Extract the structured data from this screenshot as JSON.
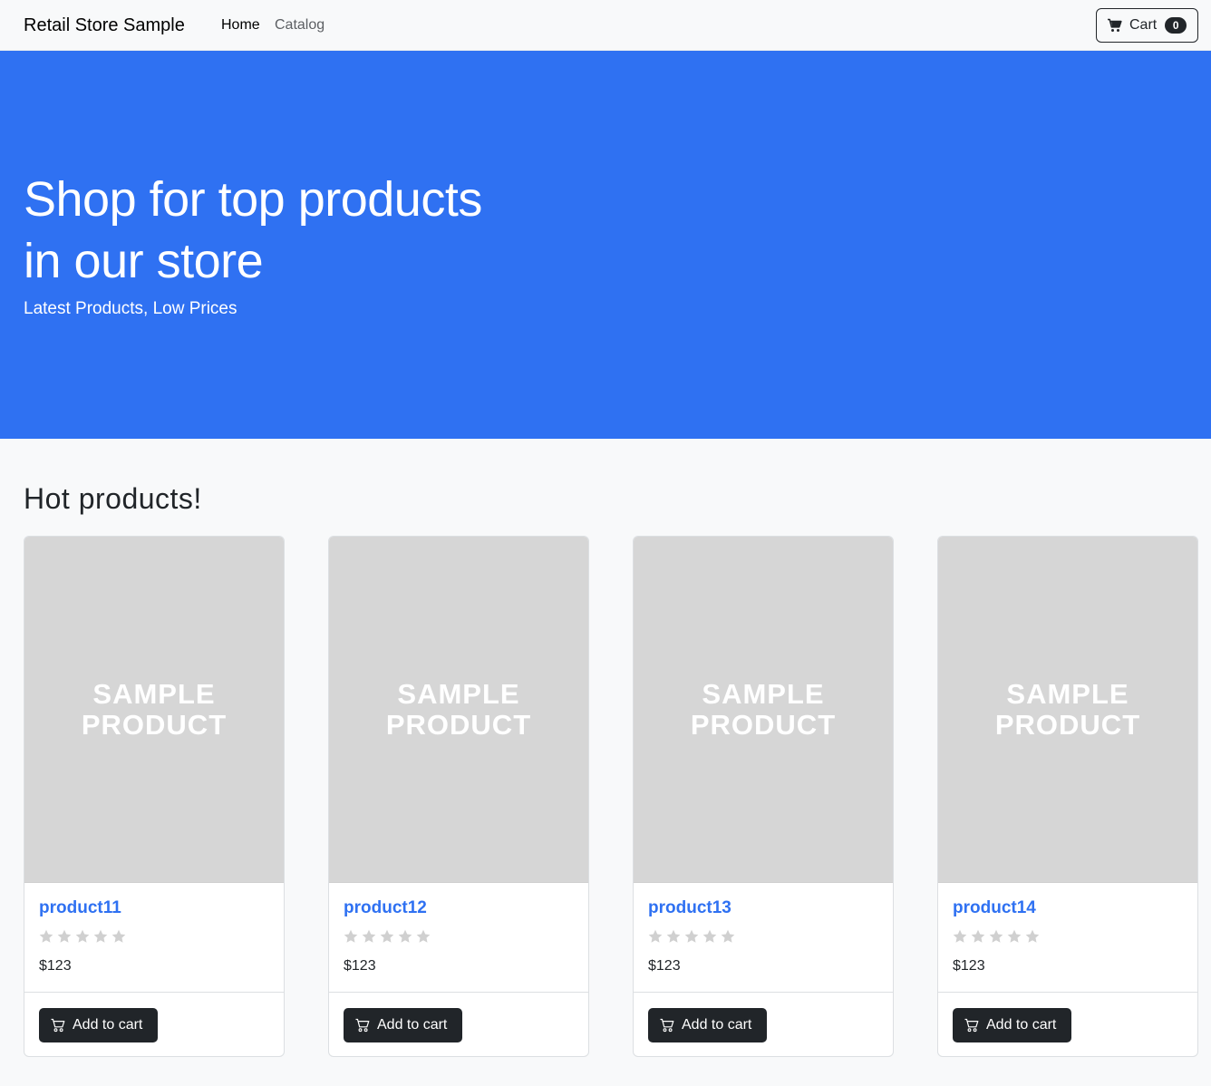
{
  "navbar": {
    "brand": "Retail Store Sample",
    "links": [
      {
        "label": "Home"
      },
      {
        "label": "Catalog"
      }
    ],
    "cart": {
      "label": "Cart",
      "count": "0",
      "icon": "cart-icon"
    }
  },
  "hero": {
    "title_line1": "Shop for top products",
    "title_line2": "in our store",
    "subtitle": "Latest Products, Low Prices",
    "background": "#2f71f2"
  },
  "section": {
    "title": "Hot products!"
  },
  "products": [
    {
      "image_text_line1": "SAMPLE",
      "image_text_line2": "PRODUCT",
      "name": "product11",
      "rating": 0,
      "max_rating": 5,
      "price": "$123",
      "button": "Add to cart"
    },
    {
      "image_text_line1": "SAMPLE",
      "image_text_line2": "PRODUCT",
      "name": "product12",
      "rating": 0,
      "max_rating": 5,
      "price": "$123",
      "button": "Add to cart"
    },
    {
      "image_text_line1": "SAMPLE",
      "image_text_line2": "PRODUCT",
      "name": "product13",
      "rating": 0,
      "max_rating": 5,
      "price": "$123",
      "button": "Add to cart"
    },
    {
      "image_text_line1": "SAMPLE",
      "image_text_line2": "PRODUCT",
      "name": "product14",
      "rating": 0,
      "max_rating": 5,
      "price": "$123",
      "button": "Add to cart"
    }
  ],
  "colors": {
    "accent": "#2f71f2",
    "dark": "#212529",
    "star_empty": "#d0d0d0",
    "image_placeholder": "#d6d6d6"
  }
}
